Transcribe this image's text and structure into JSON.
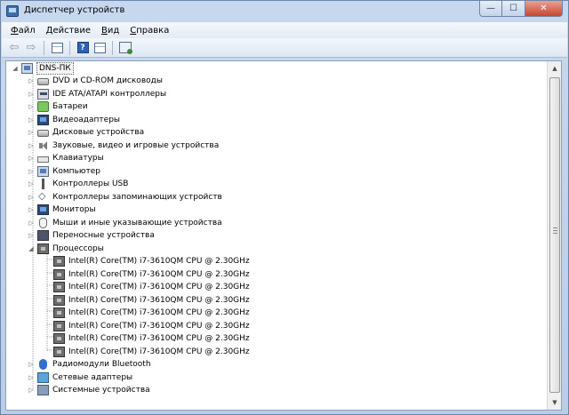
{
  "window": {
    "title": "Диспетчер устройств",
    "minimize": "—",
    "maximize": "☐",
    "close": "✕"
  },
  "menu": [
    {
      "label": "Файл",
      "ul": "Ф",
      "rest": "айл"
    },
    {
      "label": "Действие",
      "ul": "Д",
      "rest": "ействие"
    },
    {
      "label": "Вид",
      "ul": "В",
      "rest": "ид"
    },
    {
      "label": "Справка",
      "ul": "С",
      "rest": "правка"
    }
  ],
  "toolbar": {
    "icons": [
      "back-arrow-icon",
      "forward-arrow-icon",
      "properties-icon",
      "help-icon",
      "details-icon",
      "scan-hardware-icon"
    ],
    "help_glyph": "?",
    "back_glyph": "⇦",
    "forward_glyph": "⇨"
  },
  "tree": {
    "root": "DNS-ПК",
    "expand_closed": "▷",
    "expand_open": "◢",
    "categories": [
      {
        "label": "DVD и CD-ROM дисководы",
        "icon": "disk-icon"
      },
      {
        "label": "IDE ATA/ATAPI контроллеры",
        "icon": "ide-controller-icon"
      },
      {
        "label": "Батареи",
        "icon": "battery-icon"
      },
      {
        "label": "Видеоадаптеры",
        "icon": "display-adapter-icon"
      },
      {
        "label": "Дисковые устройства",
        "icon": "disk-drive-icon"
      },
      {
        "label": "Звуковые, видео и игровые устройства",
        "icon": "sound-icon"
      },
      {
        "label": "Клавиатуры",
        "icon": "keyboard-icon"
      },
      {
        "label": "Компьютер",
        "icon": "computer-icon"
      },
      {
        "label": "Контроллеры USB",
        "icon": "usb-icon"
      },
      {
        "label": "Контроллеры запоминающих устройств",
        "icon": "storage-controller-icon"
      },
      {
        "label": "Мониторы",
        "icon": "monitor-icon"
      },
      {
        "label": "Мыши и иные указывающие устройства",
        "icon": "mouse-icon"
      },
      {
        "label": "Переносные устройства",
        "icon": "portable-device-icon"
      },
      {
        "label": "Процессоры",
        "icon": "processor-icon",
        "expanded": true,
        "children": [
          "Intel(R) Core(TM) i7-3610QM CPU @ 2.30GHz",
          "Intel(R) Core(TM) i7-3610QM CPU @ 2.30GHz",
          "Intel(R) Core(TM) i7-3610QM CPU @ 2.30GHz",
          "Intel(R) Core(TM) i7-3610QM CPU @ 2.30GHz",
          "Intel(R) Core(TM) i7-3610QM CPU @ 2.30GHz",
          "Intel(R) Core(TM) i7-3610QM CPU @ 2.30GHz",
          "Intel(R) Core(TM) i7-3610QM CPU @ 2.30GHz",
          "Intel(R) Core(TM) i7-3610QM CPU @ 2.30GHz"
        ]
      },
      {
        "label": "Радиомодули Bluetooth",
        "icon": "bluetooth-icon"
      },
      {
        "label": "Сетевые адаптеры",
        "icon": "network-adapter-icon"
      },
      {
        "label": "Системные устройства",
        "icon": "system-device-icon"
      }
    ]
  },
  "scrollbar": {
    "up": "▲",
    "down": "▼"
  }
}
